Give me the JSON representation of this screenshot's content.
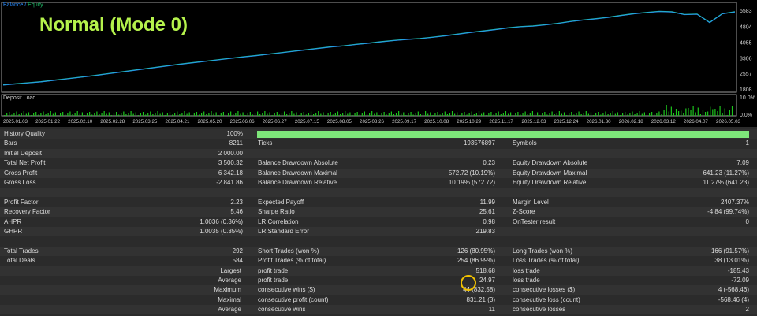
{
  "overlay_title": "Normal (Mode 0)",
  "legend": {
    "balance": "Balance",
    "sep": "/",
    "equity": "Equity"
  },
  "deposit_load_label": "Deposit Load",
  "colors": {
    "balance": "#2a8cff",
    "equity": "#1fb8b0",
    "deposit_bar": "#1cc41c",
    "title": "#b5f24c",
    "hq_bar": "#7ee67a"
  },
  "chart_data": {
    "type": "line",
    "title": "",
    "y_ticks": [
      "5583",
      "4804",
      "4055",
      "3306",
      "2557",
      "1808"
    ],
    "deposit_ticks": [
      "10.0%",
      "0.0%"
    ],
    "x_ticks": [
      "2025.01.03",
      "2025.01.22",
      "2025.02.10",
      "2025.02.28",
      "2025.03.25",
      "2025.04.21",
      "2025.05.20",
      "2025.06.06",
      "2025.06.27",
      "2025.07.15",
      "2025.08.05",
      "2025.08.26",
      "2025.09.17",
      "2025.10.08",
      "2025.10.29",
      "2025.11.17",
      "2025.12.03",
      "2025.12.24",
      "2026.01.30",
      "2026.02.18",
      "2026.03.12",
      "2026.04.07",
      "2026.05.03"
    ],
    "ylim": [
      1808,
      5583
    ],
    "series": [
      {
        "values": [
          2010,
          2060,
          2110,
          2160,
          2230,
          2300,
          2370,
          2440,
          2520,
          2600,
          2680,
          2760,
          2840,
          2920,
          3000,
          3070,
          3140,
          3210,
          3280,
          3350,
          3410,
          3480,
          3550,
          3620,
          3690,
          3760,
          3830,
          3880,
          3950,
          4010,
          4080,
          4140,
          4190,
          4230,
          4290,
          4360,
          4440,
          4520,
          4590,
          4660,
          4740,
          4800,
          4830,
          4890,
          4960,
          5050,
          5120,
          5180,
          5250,
          5340,
          5420,
          5480,
          5530,
          5510,
          5380,
          5400,
          5000,
          5420,
          5510
        ]
      }
    ]
  },
  "report": {
    "rows": [
      {
        "l1": "History Quality",
        "v1": "100%",
        "hq_bar": true
      },
      {
        "l1": "Bars",
        "v1": "8211",
        "l2": "Ticks",
        "v2": "193576897",
        "l3": "Symbols",
        "v3": "1"
      },
      {
        "l1": "Initial Deposit",
        "v1": "2 000.00"
      },
      {
        "l1": "Total Net Profit",
        "v1": "3 500.32",
        "l2": "Balance Drawdown Absolute",
        "v2": "0.23",
        "l3": "Equity Drawdown Absolute",
        "v3": "7.09"
      },
      {
        "l1": "Gross Profit",
        "v1": "6 342.18",
        "l2": "Balance Drawdown Maximal",
        "v2": "572.72 (10.19%)",
        "l3": "Equity Drawdown Maximal",
        "v3": "641.23 (11.27%)"
      },
      {
        "l1": "Gross Loss",
        "v1": "-2 841.86",
        "l2": "Balance Drawdown Relative",
        "v2": "10.19% (572.72)",
        "l3": "Equity Drawdown Relative",
        "v3": "11.27% (641.23)"
      },
      {},
      {
        "l1": "Profit Factor",
        "v1": "2.23",
        "l2": "Expected Payoff",
        "v2": "11.99",
        "l3": "Margin Level",
        "v3": "2407.37%"
      },
      {
        "l1": "Recovery Factor",
        "v1": "5.46",
        "l2": "Sharpe Ratio",
        "v2": "25.61",
        "l3": "Z-Score",
        "v3": "-4.84 (99.74%)"
      },
      {
        "l1": "AHPR",
        "v1": "1.0036 (0.36%)",
        "l2": "LR Correlation",
        "v2": "0.98",
        "l3": "OnTester result",
        "v3": "0"
      },
      {
        "l1": "GHPR",
        "v1": "1.0035 (0.35%)",
        "l2": "LR Standard Error",
        "v2": "219.83"
      },
      {},
      {
        "l1": "Total Trades",
        "v1": "292",
        "l2": "Short Trades (won %)",
        "v2": "126 (80.95%)",
        "l3": "Long Trades (won %)",
        "v3": "166 (91.57%)"
      },
      {
        "l1": "Total Deals",
        "v1": "584",
        "l2": "Profit Trades (% of total)",
        "v2": "254 (86.99%)",
        "l3": "Loss Trades (% of total)",
        "v3": "38 (13.01%)"
      },
      {
        "l1r": "Largest",
        "l2": "profit trade",
        "v2": "518.68",
        "l3": "loss trade",
        "v3": "-185.43"
      },
      {
        "l1r": "Average",
        "l2": "profit trade",
        "v2": "24.97",
        "l3": "loss trade",
        "v3": "-72.09"
      },
      {
        "l1r": "Maximum",
        "l2": "consecutive wins ($)",
        "v2": "44 (832.58)",
        "l3": "consecutive losses ($)",
        "v3": "4 (-568.46)"
      },
      {
        "l1r": "Maximal",
        "l2": "consecutive profit (count)",
        "v2": "831.21 (3)",
        "l3": "consecutive loss (count)",
        "v3": "-568.46 (4)"
      },
      {
        "l1r": "Average",
        "l2": "consecutive wins",
        "v2": "11",
        "l3": "consecutive losses",
        "v3": "2"
      }
    ]
  }
}
